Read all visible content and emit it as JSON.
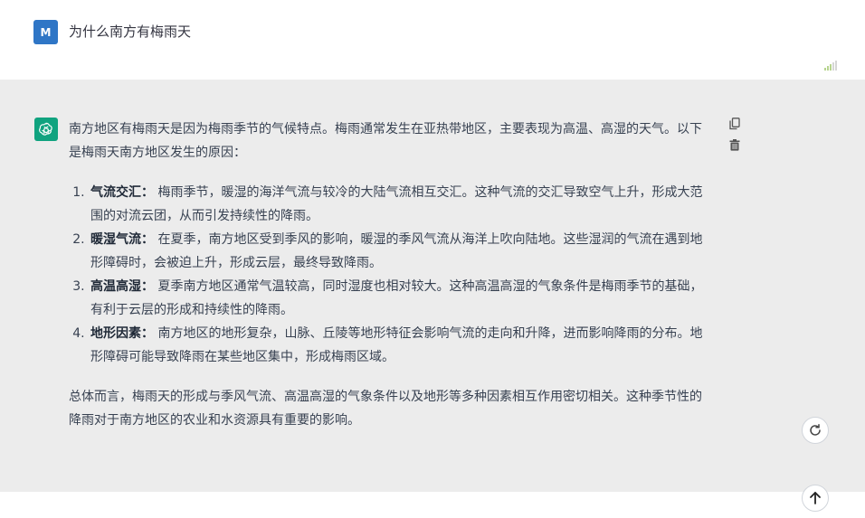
{
  "user_message": {
    "avatar_initial": "M",
    "text": "为什么南方有梅雨天"
  },
  "assistant_message": {
    "intro": "南方地区有梅雨天是因为梅雨季节的气候特点。梅雨通常发生在亚热带地区，主要表现为高温、高湿的天气。以下是梅雨天南方地区发生的原因：",
    "items": [
      {
        "term": "气流交汇：",
        "text": "梅雨季节，暖湿的海洋气流与较冷的大陆气流相互交汇。这种气流的交汇导致空气上升，形成大范围的对流云团，从而引发持续性的降雨。"
      },
      {
        "term": "暖湿气流：",
        "text": "在夏季，南方地区受到季风的影响，暖湿的季风气流从海洋上吹向陆地。这些湿润的气流在遇到地形障碍时，会被迫上升，形成云层，最终导致降雨。"
      },
      {
        "term": "高温高湿：",
        "text": "夏季南方地区通常气温较高，同时湿度也相对较大。这种高温高湿的气象条件是梅雨季节的基础，有利于云层的形成和持续性的降雨。"
      },
      {
        "term": "地形因素：",
        "text": "南方地区的地形复杂，山脉、丘陵等地形特征会影响气流的走向和升降，进而影响降雨的分布。地形障碍可能导致降雨在某些地区集中，形成梅雨区域。"
      }
    ],
    "conclusion": "总体而言，梅雨天的形成与季风气流、高温高湿的气象条件以及地形等多种因素相互作用密切相关。这种季节性的降雨对于南方地区的农业和水资源具有重要的影响。"
  },
  "icons": {
    "bot_avatar": "openai-logo-icon",
    "copy": "copy-icon",
    "delete": "trash-icon",
    "regenerate": "refresh-icon",
    "scroll_top": "arrow-up-icon",
    "signal": "signal-bars-icon"
  },
  "colors": {
    "user_avatar": "#2f76c6",
    "bot_avatar": "#10a37f",
    "assistant_bg": "#ececec"
  }
}
